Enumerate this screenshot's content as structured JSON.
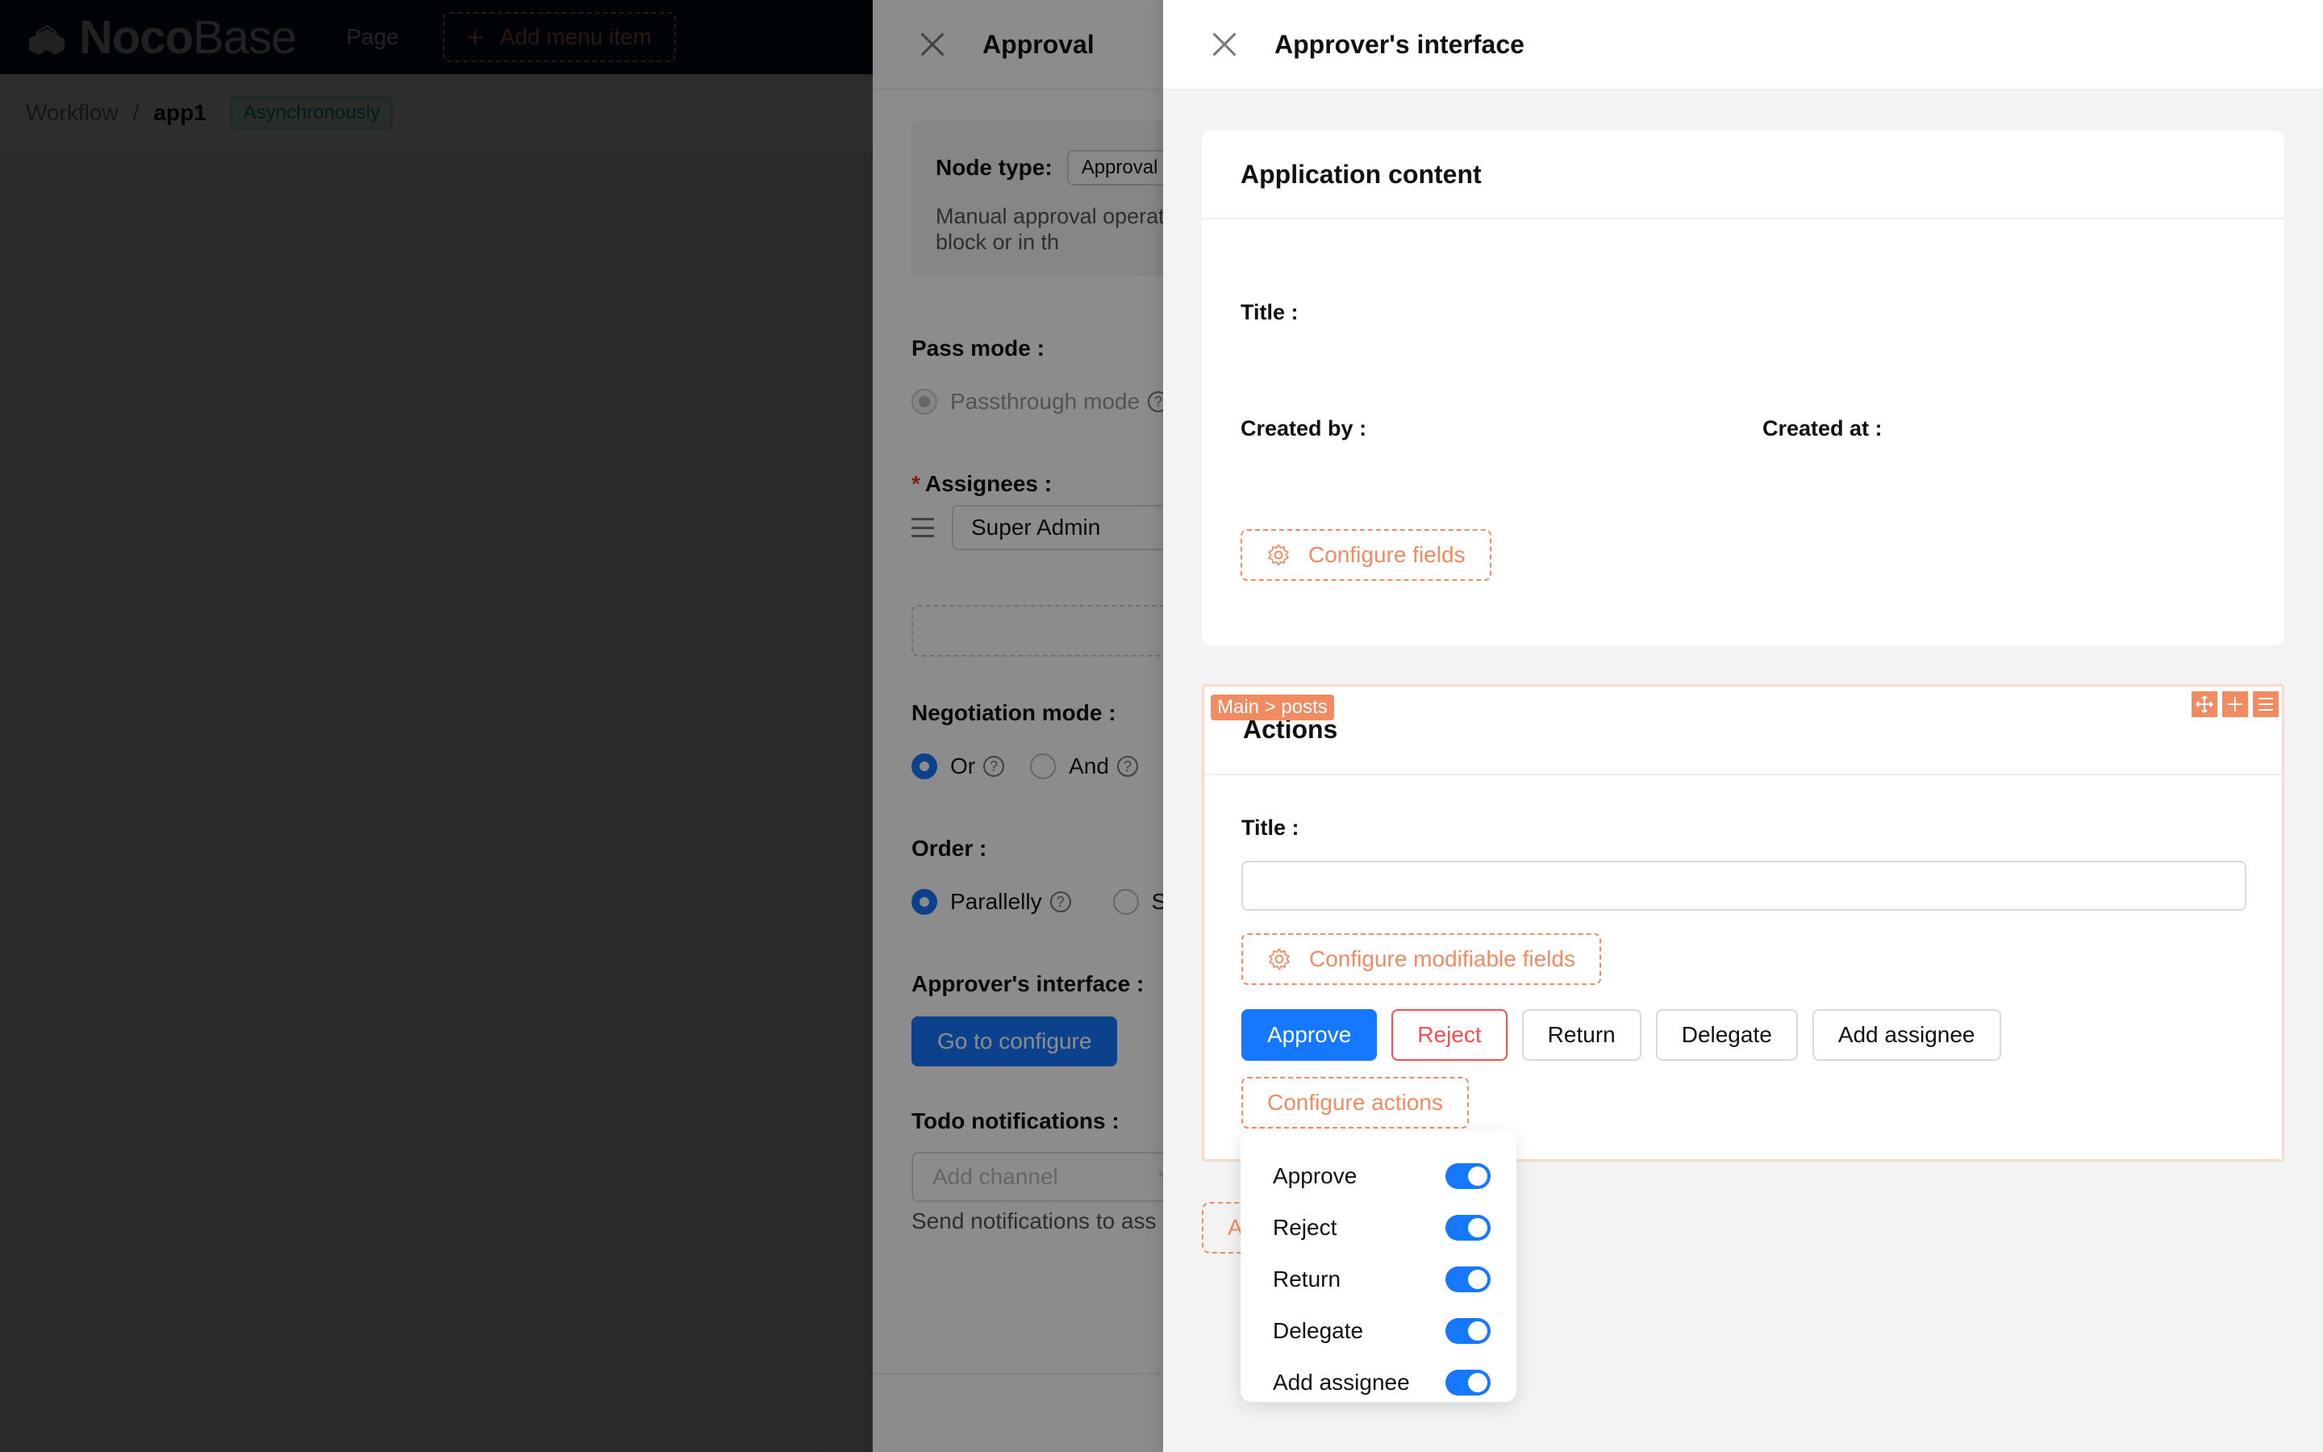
{
  "app": {
    "logo_bold": "Noco",
    "logo_light": "Base",
    "nav_page": "Page",
    "add_menu_item": "Add menu item",
    "breadcrumb": [
      "Workflow",
      "app1"
    ],
    "breadcrumb_separator": "/",
    "mode_tag": "Asynchronously"
  },
  "approval_drawer": {
    "title": "Approval",
    "node_type_label": "Node type:",
    "node_type_value": "Approval",
    "node_description": "Manual approval operation. The approver can approve in the approval block or in th",
    "pass_mode_label": "Pass mode",
    "pass_mode_option": "Passthrough mode",
    "assignees_label": "Assignees",
    "assignee_value": "Super Admin",
    "negotiation_label": "Negotiation mode",
    "negotiation_options": [
      {
        "label": "Or",
        "selected": true
      },
      {
        "label": "And",
        "selected": false
      }
    ],
    "order_label": "Order",
    "order_options": [
      {
        "label": "Parallelly",
        "selected": true
      },
      {
        "label": "S",
        "selected": false
      }
    ],
    "approver_interface_label": "Approver's interface",
    "go_configure": "Go to configure",
    "todo_label": "Todo notifications",
    "channel_placeholder": "Add channel",
    "todo_help": "Send notifications to ass"
  },
  "approver_interface": {
    "title": "Approver's interface",
    "application_content": {
      "title": "Application content",
      "fields": [
        "Title",
        "Created by",
        "Created at"
      ],
      "configure_fields": "Configure fields"
    },
    "actions_block": {
      "tag": "Main > posts",
      "title": "Actions",
      "field_label": "Title",
      "title_value": "",
      "configure_modifiable": "Configure modifiable fields",
      "buttons": [
        {
          "label": "Approve",
          "variant": "primary"
        },
        {
          "label": "Reject",
          "variant": "danger"
        },
        {
          "label": "Return",
          "variant": "default"
        },
        {
          "label": "Delegate",
          "variant": "default"
        },
        {
          "label": "Add assignee",
          "variant": "default"
        }
      ],
      "configure_actions": "Configure actions"
    },
    "add_block": "Add block"
  },
  "configure_actions_menu": [
    {
      "label": "Approve",
      "enabled": true
    },
    {
      "label": "Reject",
      "enabled": true
    },
    {
      "label": "Return",
      "enabled": true
    },
    {
      "label": "Delegate",
      "enabled": true
    },
    {
      "label": "Add assignee",
      "enabled": true
    }
  ],
  "colors": {
    "primary": "#1677ff",
    "danger": "#ff4d4f",
    "designer_orange": "#f18b62",
    "header_bg": "#001529"
  }
}
